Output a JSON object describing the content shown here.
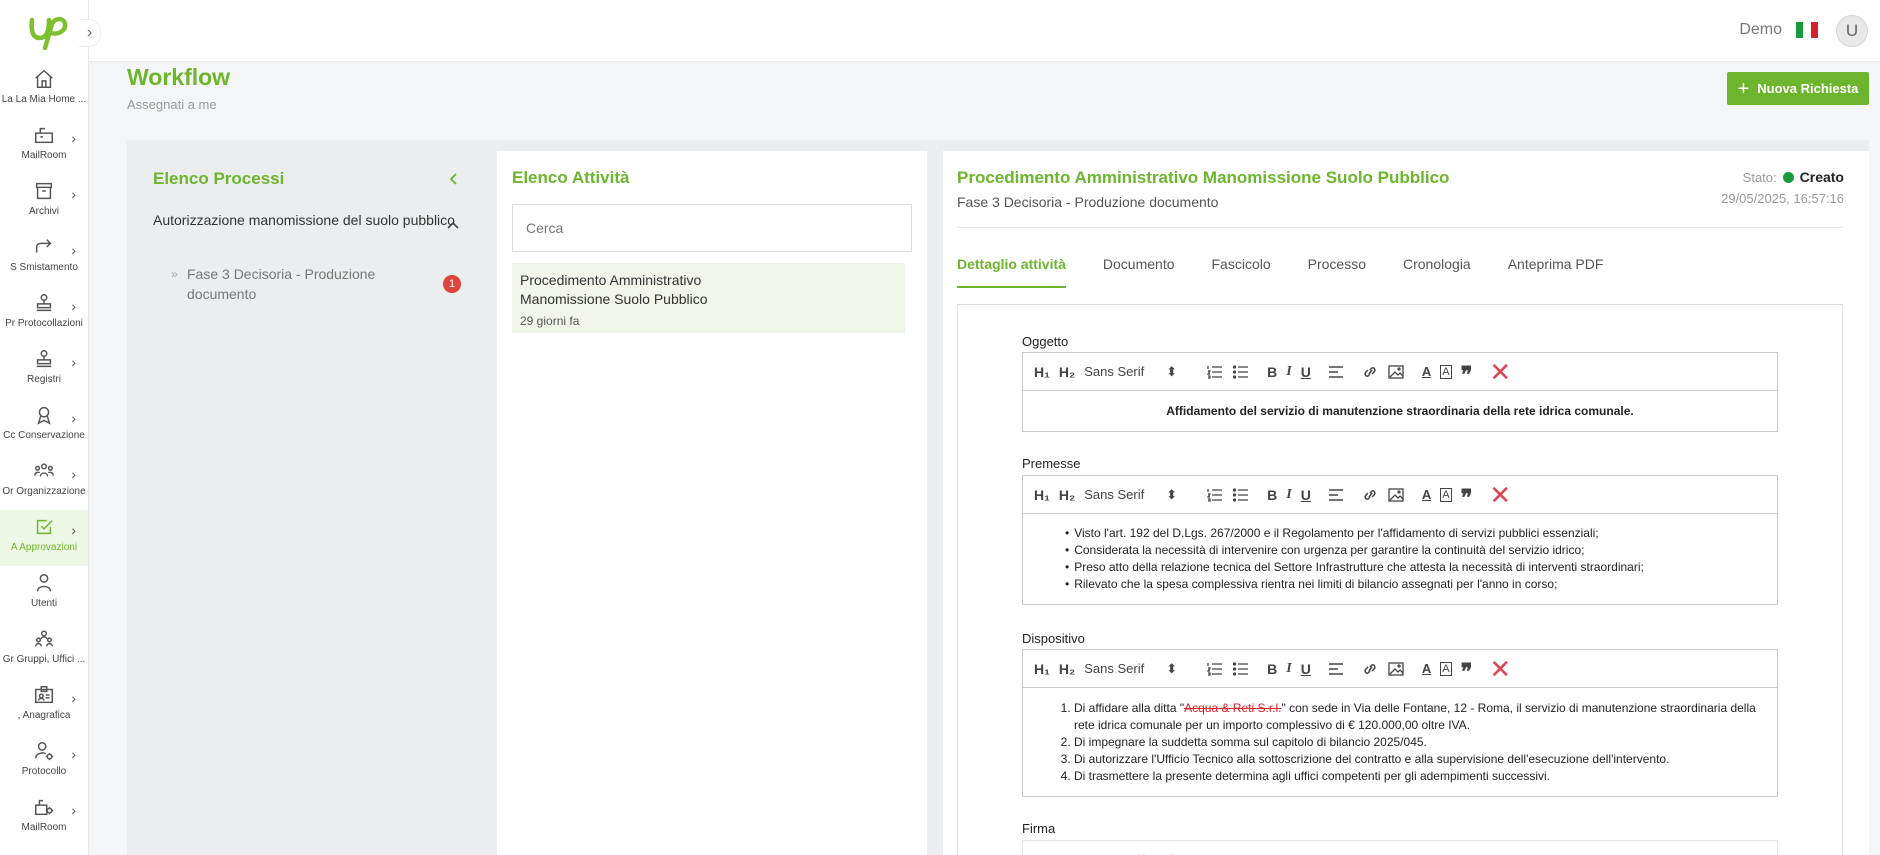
{
  "app": {
    "user_label": "Demo",
    "avatar_initial": "U",
    "collapse_glyph": "›"
  },
  "sidebar": {
    "items": [
      {
        "label": "La La Mia Home ...",
        "icon": "home-icon",
        "has_chevron": false
      },
      {
        "label": "MailRoom",
        "icon": "mailbox-icon",
        "has_chevron": true
      },
      {
        "label": "Archivi",
        "icon": "archive-icon",
        "has_chevron": true
      },
      {
        "label": "S   Smistamento",
        "icon": "forward-icon",
        "has_chevron": true
      },
      {
        "label": "Pr Protocollazioni",
        "icon": "stamp-icon",
        "has_chevron": true
      },
      {
        "label": "Registri",
        "icon": "stamp-icon",
        "has_chevron": true
      },
      {
        "label": "Cc Conservazione",
        "icon": "award-icon",
        "has_chevron": true
      },
      {
        "label": "Or Organizzazione",
        "icon": "people-icon",
        "has_chevron": true
      },
      {
        "label": "A   Approvazioni",
        "icon": "check-square-icon",
        "has_chevron": true,
        "active": true
      },
      {
        "label": "Utenti",
        "icon": "user-icon",
        "has_chevron": false
      },
      {
        "label": "Gr Gruppi, Uffici ...",
        "icon": "group-icon",
        "has_chevron": false
      },
      {
        "label": ",   Anagrafica",
        "icon": "id-card-icon",
        "has_chevron": true
      },
      {
        "label": "Protocollo",
        "icon": "user-gear-icon",
        "has_chevron": true
      },
      {
        "label": "MailRoom",
        "icon": "mailbox-gear-icon",
        "has_chevron": true
      }
    ]
  },
  "header": {
    "title": "Workflow",
    "subtitle": "Assegnati a me",
    "new_button": "Nuova Richiesta"
  },
  "processes": {
    "title": "Elenco Processi",
    "group": "Autorizzazione manomissione del suolo pubblico",
    "item": "Fase 3 Decisoria - Produzione documento",
    "item_prefix": "»",
    "badge": "1"
  },
  "activities": {
    "title": "Elenco Attività",
    "search_placeholder": "Cerca",
    "card_title": "Procedimento Amministrativo Manomissione Suolo Pubblico",
    "card_time": "29 giorni fa"
  },
  "detail": {
    "title": "Procedimento Amministrativo Manomissione Suolo Pubblico",
    "subtitle": "Fase 3 Decisoria - Produzione documento",
    "state_label": "Stato:",
    "state_value": "Creato",
    "state_color": "#1a9a3f",
    "date": "29/05/2025, 16:57:16",
    "tabs": [
      "Dettaglio attività",
      "Documento",
      "Fascicolo",
      "Processo",
      "Cronologia",
      "Anteprima PDF"
    ],
    "active_tab": 0
  },
  "toolbar": {
    "h1": "H₁",
    "h2": "H₂",
    "font": "Sans Serif",
    "bold": "B",
    "italic": "I",
    "underline": "U",
    "quote": "❞",
    "clear": "✕"
  },
  "fields": {
    "oggetto_label": "Oggetto",
    "oggetto_text": "Affidamento del servizio di manutenzione straordinaria della rete idrica comunale.",
    "premesse_label": "Premesse",
    "premesse": [
      "Visto l'art. 192 del D.Lgs. 267/2000 e il Regolamento per l'affidamento di servizi pubblici essenziali;",
      "Considerata la necessità di intervenire con urgenza per garantire la continuità del servizio idrico;",
      "Preso atto della relazione tecnica del Settore Infrastrutture che attesta la necessità di interventi straordinari;",
      "Rilevato che la spesa complessiva rientra nei limiti di bilancio assegnati per l'anno in corso;"
    ],
    "dispositivo_label": "Dispositivo",
    "dispositivo_1_pre": "Di affidare alla ditta \"",
    "dispositivo_1_strike": "Acqua & Reti S.r.l.",
    "dispositivo_1_post": "\" con sede in Via delle Fontane, 12 - Roma, il servizio di manutenzione straordinaria della rete idrica comunale per un importo complessivo di € 120.000,00 oltre IVA.",
    "dispositivo_rest": [
      "Di impegnare la suddetta somma sul capitolo di bilancio 2025/045.",
      "Di autorizzare l'Ufficio Tecnico alla sottoscrizione del contratto e alla supervisione dell'esecuzione dell'intervento.",
      "Di trasmettere la presente determina agli uffici competenti per gli adempimenti successivi."
    ],
    "firma_label": "Firma"
  }
}
